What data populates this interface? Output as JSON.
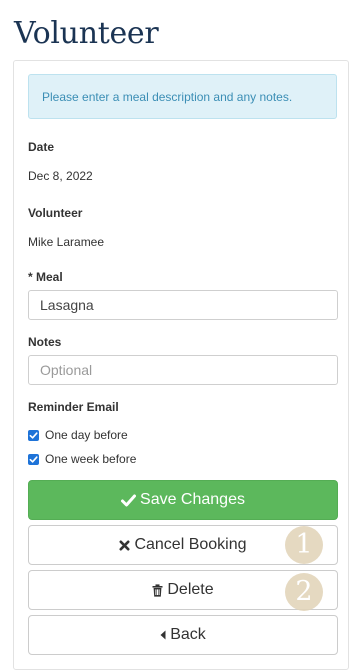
{
  "page": {
    "title": "Volunteer"
  },
  "alert": {
    "text": "Please enter a meal description and any notes."
  },
  "form": {
    "date": {
      "label": "Date",
      "value": "Dec 8, 2022"
    },
    "volunteer": {
      "label": "Volunteer",
      "value": "Mike Laramee"
    },
    "meal": {
      "label": "* Meal",
      "value": "Lasagna"
    },
    "notes": {
      "label": "Notes",
      "value": "",
      "placeholder": "Optional"
    },
    "reminder": {
      "label": "Reminder Email",
      "options": [
        {
          "label": "One day before",
          "checked": true
        },
        {
          "label": "One week before",
          "checked": true
        }
      ]
    }
  },
  "actions": {
    "save_label": "Save Changes",
    "cancel_label": "Cancel Booking",
    "delete_label": "Delete",
    "back_label": "Back"
  },
  "annotations": {
    "badge_1": "1",
    "badge_2": "2"
  },
  "colors": {
    "title": "#1b3453",
    "alert_bg": "#dff1f8",
    "alert_text": "#3b8eb5",
    "primary_button": "#5cb85c",
    "checkbox": "#1e73d8",
    "badge": "#e0d2b6"
  },
  "icons": {
    "save": "check-icon",
    "cancel": "times-icon",
    "delete": "trash-icon",
    "back": "caret-left-icon"
  }
}
